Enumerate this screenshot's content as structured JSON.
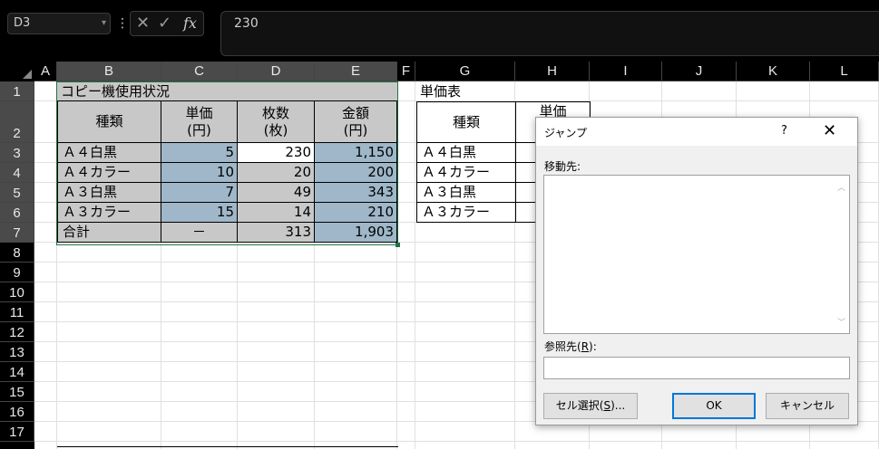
{
  "formula_bar": {
    "name_box": "D3",
    "formula": "230"
  },
  "columns": [
    "A",
    "B",
    "C",
    "D",
    "E",
    "F",
    "G",
    "H",
    "I",
    "J",
    "K",
    "L"
  ],
  "rows": [
    "1",
    "2",
    "3",
    "4",
    "5",
    "6",
    "7",
    "8",
    "9",
    "10",
    "11",
    "12",
    "13",
    "14",
    "15",
    "16",
    "17"
  ],
  "table1": {
    "title": "コピー機使用状況",
    "headers": [
      "種類",
      "単価\n(円)",
      "枚数\n(枚)",
      "金額\n(円)"
    ],
    "h_type": "種類",
    "h_price_1": "単価",
    "h_price_2": "(円)",
    "h_count_1": "枚数",
    "h_count_2": "(枚)",
    "h_amount_1": "金額",
    "h_amount_2": "(円)",
    "rows": [
      {
        "type": "Ａ４白黒",
        "price": "5",
        "count": "230",
        "amount": "1,150"
      },
      {
        "type": "Ａ４カラー",
        "price": "10",
        "count": "20",
        "amount": "200"
      },
      {
        "type": "Ａ３白黒",
        "price": "7",
        "count": "49",
        "amount": "343"
      },
      {
        "type": "Ａ３カラー",
        "price": "15",
        "count": "14",
        "amount": "210"
      }
    ],
    "total": {
      "type": "合計",
      "price": "－",
      "count": "313",
      "amount": "1,903"
    }
  },
  "table2": {
    "title": "単価表",
    "h_type": "種類",
    "h_price": "単価",
    "rows": [
      "Ａ４白黒",
      "Ａ４カラー",
      "Ａ３白黒",
      "Ａ３カラー"
    ]
  },
  "dialog": {
    "title": "ジャンプ",
    "help": "?",
    "close": "✕",
    "goto_label": "移動先:",
    "ref_label_pre": "参照先(",
    "ref_label_key": "R",
    "ref_label_post": "):",
    "special_pre": "セル選択(",
    "special_key": "S",
    "special_post": ")...",
    "ok": "OK",
    "cancel": "キャンセル"
  },
  "colors": {
    "header_gray": "#c8c8c8",
    "calc_blue": "#9fb7c8",
    "selection_green": "#217346"
  }
}
